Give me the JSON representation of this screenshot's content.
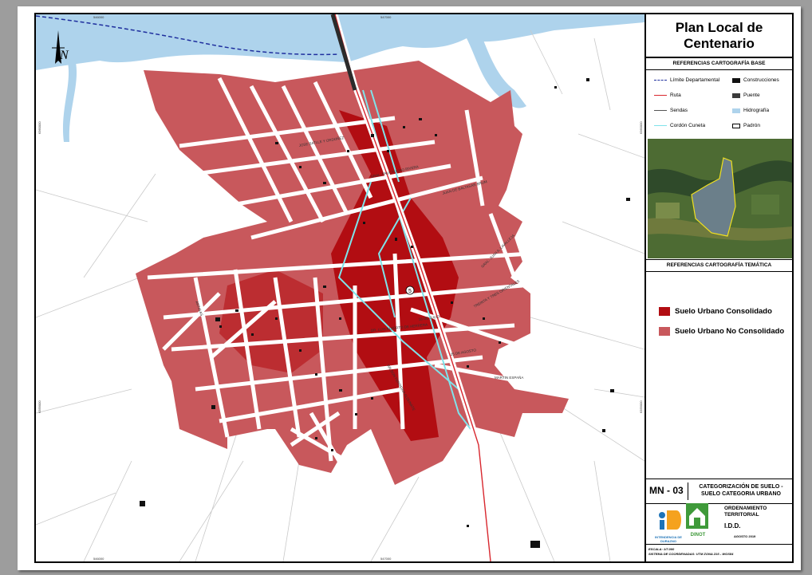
{
  "map": {
    "coords_top": [
      "546000",
      "547000"
    ],
    "coords_bottom": [
      "546000",
      "547000"
    ],
    "coords_left": [
      "6360000",
      "6359000"
    ],
    "coords_right": [
      "6360000",
      "6359000"
    ],
    "route_number": "5",
    "streets": [
      "JOSE BATLLE Y ORDOÑEZ",
      "GRAL. FRUCTUOSO RIVERA",
      "18 DE JULIO",
      "DR. LUIS ALBERTO DE HERRERA",
      "25 DE AGOSTO",
      "TREINTA Y TRES ORIENTALES",
      "MARTIN ESPAÑA",
      "GRAL. JUAN A. LAVALLEJA",
      "JUAN DE BALTASAR BRUM",
      "WILSON FERREIRA ALDUNATE",
      "ARTIGAS"
    ]
  },
  "panel": {
    "title": "Plan Local de Centenario",
    "base_header": "REFERENCIAS CARTOGRAFÍA BASE",
    "base_legend": [
      {
        "label": "Límite Departamental",
        "icon": "dashed-line-icon",
        "color": "#1f2f9e"
      },
      {
        "label": "Construcciones",
        "icon": "black-box-icon",
        "color": "#111111"
      },
      {
        "label": "Ruta",
        "icon": "red-line-icon",
        "color": "#d8272e"
      },
      {
        "label": "Puente",
        "icon": "dark-box-icon",
        "color": "#3b3b3b"
      },
      {
        "label": "Sendas",
        "icon": "gray-line-icon",
        "color": "#555555"
      },
      {
        "label": "Hidrografía",
        "icon": "blue-box-icon",
        "color": "#aed3ec"
      },
      {
        "label": "Cordón Cuneta",
        "icon": "cyan-line-icon",
        "color": "#7fe3ea"
      },
      {
        "label": "Padrón",
        "icon": "outline-box-icon",
        "color": "#000000"
      }
    ],
    "thematic_header": "REFERENCIAS CARTOGRAFÍA TEMÁTICA",
    "thematic_legend": [
      {
        "label": "Suelo Urbano Consolidado",
        "color": "#b20d12"
      },
      {
        "label": "Suelo Urbano No Consolidado",
        "color": "#c8585c"
      }
    ],
    "map_code": "MN - 03",
    "map_desc": "CATEGORIZACIÓN DE SUELO - SUELO CATEGORIA URBANO",
    "logo1_text": "INTENDENCIA DE DURAZNO",
    "logo2_text": "DINOT",
    "org_lines": [
      "ORDENAMIENTO TERRITORIAL",
      "I.D.D."
    ],
    "date": "AGOSTO 2019",
    "scale": "ESCALA: 1/7.000",
    "crs": "SISTEMA DE COORDENADAS: UTM ZONA 21S - WGS84"
  }
}
